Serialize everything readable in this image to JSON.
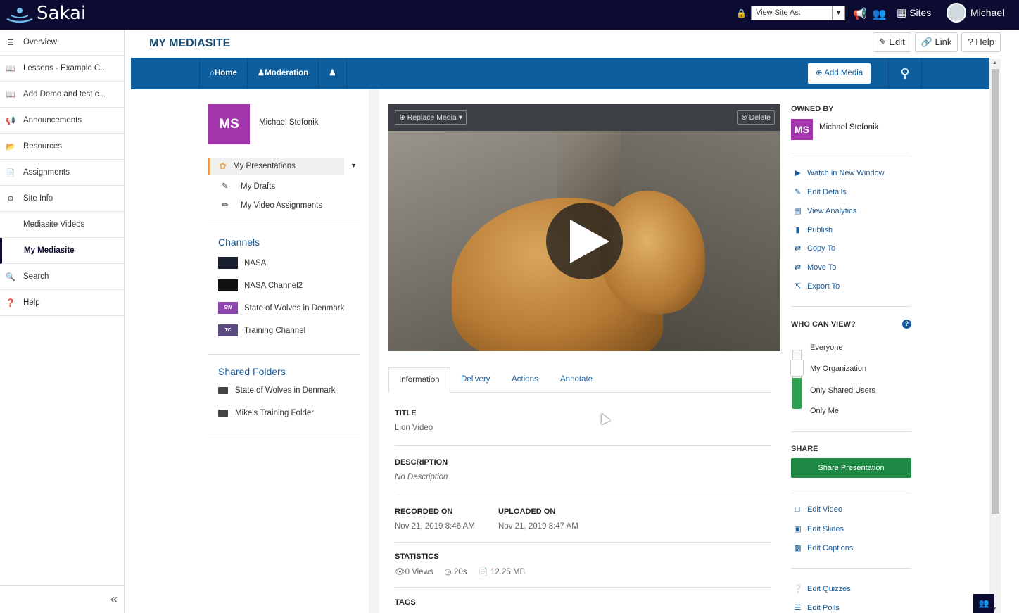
{
  "topbar": {
    "brand": "Sakai",
    "view_site_as_label": "View Site As:",
    "sites_label": "Sites",
    "user_name": "Michael"
  },
  "sidebar": {
    "items": [
      {
        "label": "Overview",
        "icon": "list-icon"
      },
      {
        "label": "Lessons - Example C...",
        "icon": "book-icon"
      },
      {
        "label": "Add Demo and test c...",
        "icon": "book-icon"
      },
      {
        "label": "Announcements",
        "icon": "megaphone-icon"
      },
      {
        "label": "Resources",
        "icon": "folder-icon"
      },
      {
        "label": "Assignments",
        "icon": "file-icon"
      },
      {
        "label": "Site Info",
        "icon": "gear-icon"
      },
      {
        "label": "Mediasite Videos",
        "icon": ""
      },
      {
        "label": "My Mediasite",
        "icon": ""
      },
      {
        "label": "Search",
        "icon": "search-icon"
      },
      {
        "label": "Help",
        "icon": "help-icon"
      }
    ]
  },
  "page": {
    "title": "MY MEDIASITE",
    "edit_label": "Edit",
    "link_label": "Link",
    "help_label": "Help"
  },
  "nav": {
    "home": "Home",
    "moderation": "Moderation",
    "add_media": "Add Media"
  },
  "left": {
    "avatar_initials": "MS",
    "user_name": "Michael Stefonik",
    "my_presentations": "My Presentations",
    "my_drafts": "My Drafts",
    "my_video_assignments": "My Video Assignments",
    "channels_heading": "Channels",
    "channels": [
      {
        "name": "NASA",
        "badge": ""
      },
      {
        "name": "NASA Channel2",
        "badge": ""
      },
      {
        "name": "State of Wolves in Denmark",
        "badge": "SW"
      },
      {
        "name": "Training Channel",
        "badge": "TC"
      }
    ],
    "shared_folders_heading": "Shared Folders",
    "shared_folders": [
      "State of Wolves in Denmark",
      "Mike's Training Folder"
    ]
  },
  "player": {
    "replace_media": "Replace Media",
    "delete": "Delete"
  },
  "tabs": [
    "Information",
    "Delivery",
    "Actions",
    "Annotate"
  ],
  "info": {
    "title_label": "TITLE",
    "title_value": "Lion Video",
    "description_label": "DESCRIPTION",
    "description_value": "No Description",
    "recorded_label": "RECORDED ON",
    "recorded_value": "Nov 21, 2019 8:46 AM",
    "uploaded_label": "UPLOADED ON",
    "uploaded_value": "Nov 21, 2019 8:47 AM",
    "statistics_label": "STATISTICS",
    "views": "0 Views",
    "duration": "20s",
    "size": "12.25 MB",
    "tags_label": "TAGS"
  },
  "right": {
    "owned_by_label": "OWNED BY",
    "owner_initials": "MS",
    "owner_name": "Michael Stefonik",
    "actions": [
      {
        "label": "Watch in New Window",
        "icon": "play-circle-icon"
      },
      {
        "label": "Edit Details",
        "icon": "edit-icon"
      },
      {
        "label": "View Analytics",
        "icon": "chart-icon"
      },
      {
        "label": "Publish",
        "icon": "book-icon"
      },
      {
        "label": "Copy To",
        "icon": "exchange-icon"
      },
      {
        "label": "Move To",
        "icon": "exchange-icon"
      },
      {
        "label": "Export To",
        "icon": "export-icon"
      }
    ],
    "who_can_view_label": "WHO CAN VIEW?",
    "view_options": [
      "Everyone",
      "My Organization",
      "Only Shared Users",
      "Only Me"
    ],
    "share_label": "SHARE",
    "share_button": "Share Presentation",
    "edit_links": [
      {
        "label": "Edit Video",
        "icon": "monitor-icon"
      },
      {
        "label": "Edit Slides",
        "icon": "image-icon"
      },
      {
        "label": "Edit Captions",
        "icon": "captions-icon"
      }
    ],
    "quiz_links": [
      {
        "label": "Edit Quizzes",
        "icon": "question-icon"
      },
      {
        "label": "Edit Polls",
        "icon": "list-icon"
      }
    ]
  }
}
